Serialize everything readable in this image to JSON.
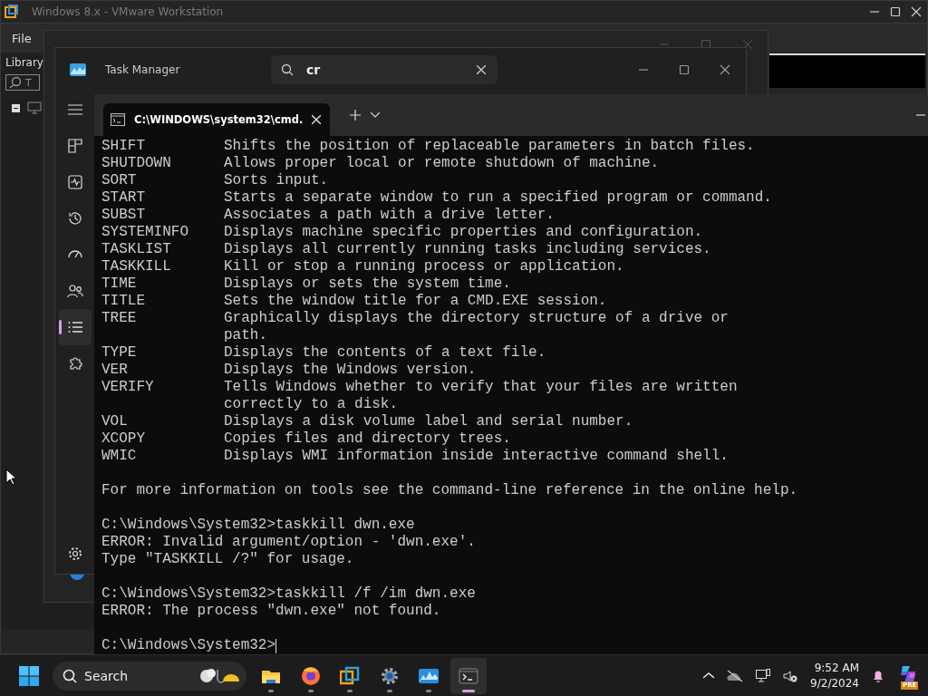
{
  "vmware": {
    "title": "Windows 8.x - VMware Workstation",
    "menu": [
      "File"
    ],
    "library": {
      "label": "Library",
      "search": {
        "placeholder": "T"
      },
      "tree": [
        {
          "expanded": true
        }
      ]
    }
  },
  "task_manager": {
    "title": "Task Manager",
    "search": {
      "value": "cr"
    },
    "nav": [
      {
        "kind": "processes",
        "selected": false
      },
      {
        "kind": "performance",
        "selected": false
      },
      {
        "kind": "history",
        "selected": false
      },
      {
        "kind": "startup",
        "selected": false
      },
      {
        "kind": "users",
        "selected": false
      },
      {
        "kind": "details",
        "selected": true
      },
      {
        "kind": "services",
        "selected": false
      }
    ]
  },
  "terminal": {
    "tabs": [
      {
        "title": "C:\\WINDOWS\\system32\\cmd.",
        "selected": true
      }
    ],
    "lines": [
      {
        "kind": "help",
        "command": "SHIFT",
        "description": "Shifts the position of replaceable parameters in batch files."
      },
      {
        "kind": "help",
        "command": "SHUTDOWN",
        "description": "Allows proper local or remote shutdown of machine."
      },
      {
        "kind": "help",
        "command": "SORT",
        "description": "Sorts input."
      },
      {
        "kind": "help",
        "command": "START",
        "description": "Starts a separate window to run a specified program or command."
      },
      {
        "kind": "help",
        "command": "SUBST",
        "description": "Associates a path with a drive letter."
      },
      {
        "kind": "help",
        "command": "SYSTEMINFO",
        "description": "Displays machine specific properties and configuration."
      },
      {
        "kind": "help",
        "command": "TASKLIST",
        "description": "Displays all currently running tasks including services."
      },
      {
        "kind": "help",
        "command": "TASKKILL",
        "description": "Kill or stop a running process or application."
      },
      {
        "kind": "help",
        "command": "TIME",
        "description": "Displays or sets the system time."
      },
      {
        "kind": "help",
        "command": "TITLE",
        "description": "Sets the window title for a CMD.EXE session."
      },
      {
        "kind": "help",
        "command": "TREE",
        "description": "Graphically displays the directory structure of a drive or"
      },
      {
        "kind": "continued",
        "description": "path."
      },
      {
        "kind": "help",
        "command": "TYPE",
        "description": "Displays the contents of a text file."
      },
      {
        "kind": "help",
        "command": "VER",
        "description": "Displays the Windows version."
      },
      {
        "kind": "help",
        "command": "VERIFY",
        "description": "Tells Windows whether to verify that your files are written"
      },
      {
        "kind": "continued",
        "description": "correctly to a disk."
      },
      {
        "kind": "help",
        "command": "VOL",
        "description": "Displays a disk volume label and serial number."
      },
      {
        "kind": "help",
        "command": "XCOPY",
        "description": "Copies files and directory trees."
      },
      {
        "kind": "help",
        "command": "WMIC",
        "description": "Displays WMI information inside interactive command shell."
      },
      {
        "kind": "blank"
      },
      {
        "kind": "text",
        "text": "For more information on tools see the command-line reference in the online help."
      },
      {
        "kind": "blank"
      },
      {
        "kind": "text",
        "text": "C:\\Windows\\System32>taskkill dwn.exe"
      },
      {
        "kind": "text",
        "text": "ERROR: Invalid argument/option - 'dwn.exe'."
      },
      {
        "kind": "text",
        "text": "Type \"TASKKILL /?\" for usage."
      },
      {
        "kind": "blank"
      },
      {
        "kind": "text",
        "text": "C:\\Windows\\System32>taskkill /f /im dwn.exe"
      },
      {
        "kind": "text",
        "text": "ERROR: The process \"dwn.exe\" not found."
      },
      {
        "kind": "blank"
      },
      {
        "kind": "prompt",
        "text": "C:\\Windows\\System32>"
      }
    ]
  },
  "taskbar": {
    "search": {
      "placeholder": "Search"
    },
    "apps": [
      {
        "kind": "folder",
        "active": false
      },
      {
        "kind": "browser",
        "active": false
      },
      {
        "kind": "vm",
        "active": false
      },
      {
        "kind": "settings",
        "active": false
      },
      {
        "kind": "monitor",
        "active": false
      },
      {
        "kind": "terminal",
        "active": true
      }
    ],
    "time": "9:52 AM",
    "date": "9/2/2024",
    "copilot_badge": "PRE"
  }
}
